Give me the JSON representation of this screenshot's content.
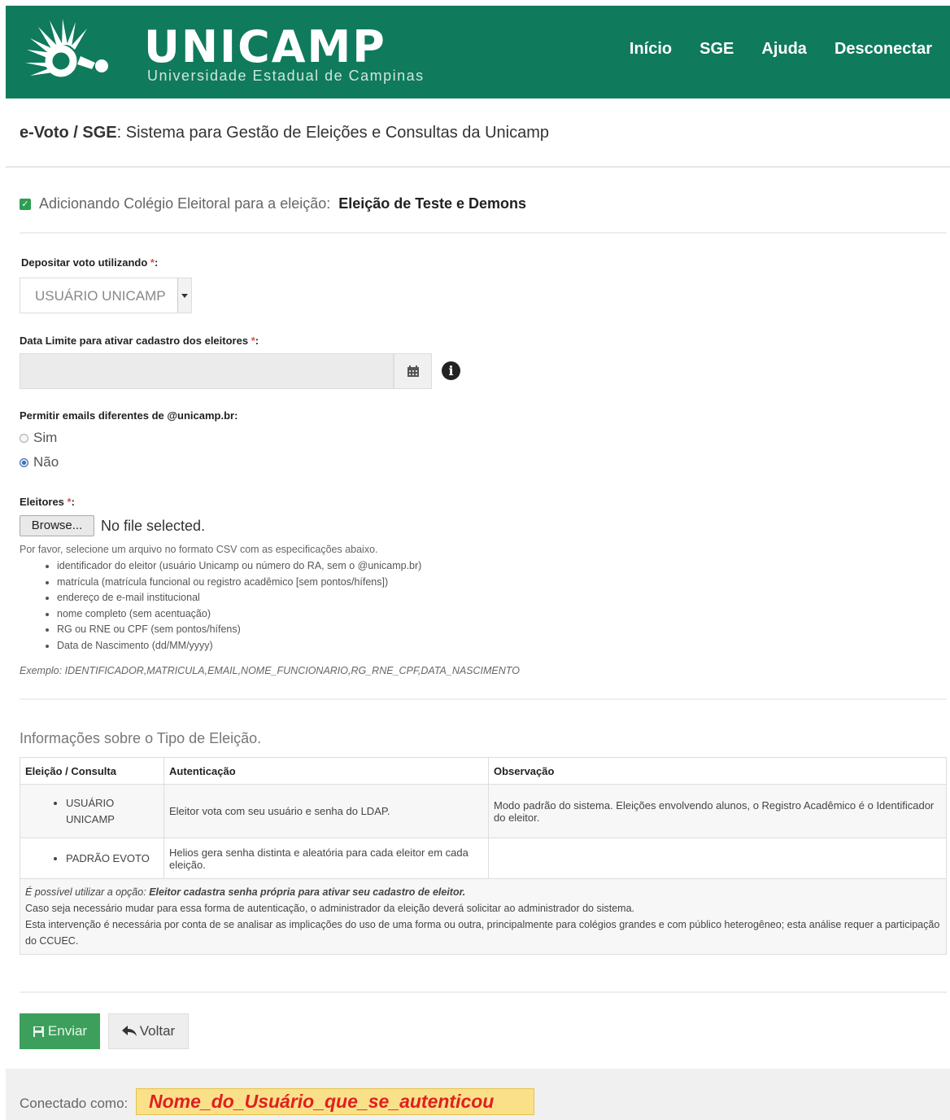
{
  "header": {
    "brand": "UNICAMP",
    "brand_subtitle": "Universidade Estadual de Campinas",
    "nav": [
      "Início",
      "SGE",
      "Ajuda",
      "Desconectar"
    ]
  },
  "subheader": {
    "app_short": "e-Voto / SGE",
    "app_desc": ": Sistema para Gestão de Eleições e Consultas da Unicamp"
  },
  "notice": {
    "text": "Adicionando Colégio Eleitoral para a eleição:",
    "election": "Eleição de Teste e Demons"
  },
  "form": {
    "vote_method_label": "Depositar voto utilizando",
    "vote_method_value": "USUÁRIO UNICAMP",
    "deadline_label": "Data Limite para ativar cadastro dos eleitores",
    "deadline_value": "",
    "emails_label": "Permitir emails diferentes de @unicamp.br:",
    "emails_options": [
      "Sim",
      "Não"
    ],
    "emails_selected": "Não",
    "voters_label": "Eleitores",
    "required_mark": "*",
    "label_colon": ":",
    "browse_label": "Browse...",
    "no_file": "No file selected.",
    "help_intro": "Por favor, selecione um arquivo no formato CSV com as especificações abaixo.",
    "help_items": [
      "identificador do eleitor (usuário Unicamp ou número do RA, sem o @unicamp.br)",
      "matrícula (matrícula funcional ou registro acadêmico [sem pontos/hífens])",
      "endereço de e-mail institucional",
      "nome completo (sem acentuação)",
      "RG ou RNE ou CPF (sem pontos/hífens)",
      "Data de Nascimento (dd/MM/yyyy)"
    ],
    "example_label": "Exemplo:",
    "example_value": "IDENTIFICADOR,MATRICULA,EMAIL,NOME_FUNCIONARIO,RG_RNE_CPF,DATA_NASCIMENTO"
  },
  "info": {
    "title": "Informações sobre o Tipo de Eleição.",
    "columns": [
      "Eleição / Consulta",
      "Autenticação",
      "Observação"
    ],
    "rows": [
      {
        "type": "USUÁRIO UNICAMP",
        "auth": "Eleitor vota com seu usuário e senha do LDAP.",
        "obs": "Modo padrão do sistema. Eleições envolvendo alunos, o Registro Acadêmico é o Identificador do eleitor."
      },
      {
        "type": "PADRÃO EVOTO",
        "auth": "Helios gera senha distinta e aleatória para cada eleitor em cada eleição.",
        "obs": ""
      }
    ],
    "note_prefix": "É possível utilizar a opção:",
    "note_option": "Eleitor cadastra senha própria para ativar seu cadastro de eleitor.",
    "note_line2": "Caso seja necessário mudar para essa forma de autenticação, o administrador da eleição deverá solicitar ao administrador do sistema.",
    "note_line3": "Esta intervenção é necessária por conta de se analisar as implicações do uso de uma forma ou outra, principalmente para colégios grandes e com público heterogêneo; esta análise requer a participação do CCUEC."
  },
  "buttons": {
    "send": "Enviar",
    "back": "Voltar"
  },
  "footer": {
    "connected_as": "Conectado como:",
    "user": "Nome_do_Usuário_que_se_autenticou"
  },
  "colors": {
    "header_bg": "#0f7a5c",
    "send_bg": "#3ca05c",
    "highlight": "#fbe08a",
    "highlight_text": "#e02020"
  }
}
